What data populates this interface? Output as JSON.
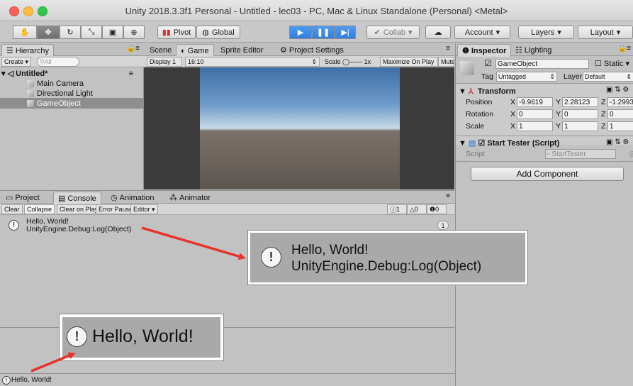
{
  "window": {
    "title": "Unity 2018.3.3f1 Personal - Untitled - lec03 - PC, Mac & Linux Standalone (Personal) <Metal>"
  },
  "toolbar": {
    "pivot_label": "Pivot",
    "global_label": "Global",
    "collab_label": "Collab",
    "account_label": "Account",
    "layers_label": "Layers",
    "layout_label": "Layout"
  },
  "hierarchy": {
    "tab_label": "Hierarchy",
    "create_label": "Create",
    "search_placeholder": "All",
    "scene_name": "Untitled*",
    "items": [
      {
        "label": "Main Camera"
      },
      {
        "label": "Directional Light"
      },
      {
        "label": "GameObject"
      }
    ]
  },
  "center_tabs": {
    "scene": "Scene",
    "game": "Game",
    "sprite_editor": "Sprite Editor",
    "project_settings": "Project Settings"
  },
  "game_bar": {
    "display": "Display 1",
    "aspect": "16:10",
    "scale_label": "Scale",
    "scale_value": "1x",
    "maximize": "Maximize On Play",
    "mute": "Mute"
  },
  "bottom_tabs": {
    "project": "Project",
    "console": "Console",
    "animation": "Animation",
    "animator": "Animator"
  },
  "console": {
    "buttons": {
      "clear": "Clear",
      "collapse": "Collapse",
      "clear_on_play": "Clear on Play",
      "error_pause": "Error Pause",
      "editor": "Editor"
    },
    "counts": {
      "info": "1",
      "warning": "0",
      "error": "0"
    },
    "entry": {
      "line1": "Hello, World!",
      "line2": "UnityEngine.Debug:Log(Object)",
      "count": "1"
    },
    "zoom_text1": "Hello, World!",
    "zoom_text2": "UnityEngine.Debug:Log(Object)",
    "zoom_status": "Hello, World!",
    "status_text": "Hello, World!"
  },
  "inspector": {
    "tab_label": "Inspector",
    "lighting_label": "Lighting",
    "object_name": "GameObject",
    "static_label": "Static",
    "tag_label": "Tag",
    "tag_value": "Untagged",
    "layer_label": "Layer",
    "layer_value": "Default",
    "transform": {
      "title": "Transform",
      "position_label": "Position",
      "rotation_label": "Rotation",
      "scale_label": "Scale",
      "px": "-9.9619",
      "py": "2.28123",
      "pz": "-1.2993",
      "rx": "0",
      "ry": "0",
      "rz": "0",
      "sx": "1",
      "sy": "1",
      "sz": "1"
    },
    "script_component": {
      "title": "Start Tester (Script)",
      "script_label": "Script",
      "script_value": "StartTester"
    },
    "add_component": "Add Component"
  },
  "colors": {
    "arrow": "#e8322a",
    "play_blue": "#2f7ee0"
  }
}
